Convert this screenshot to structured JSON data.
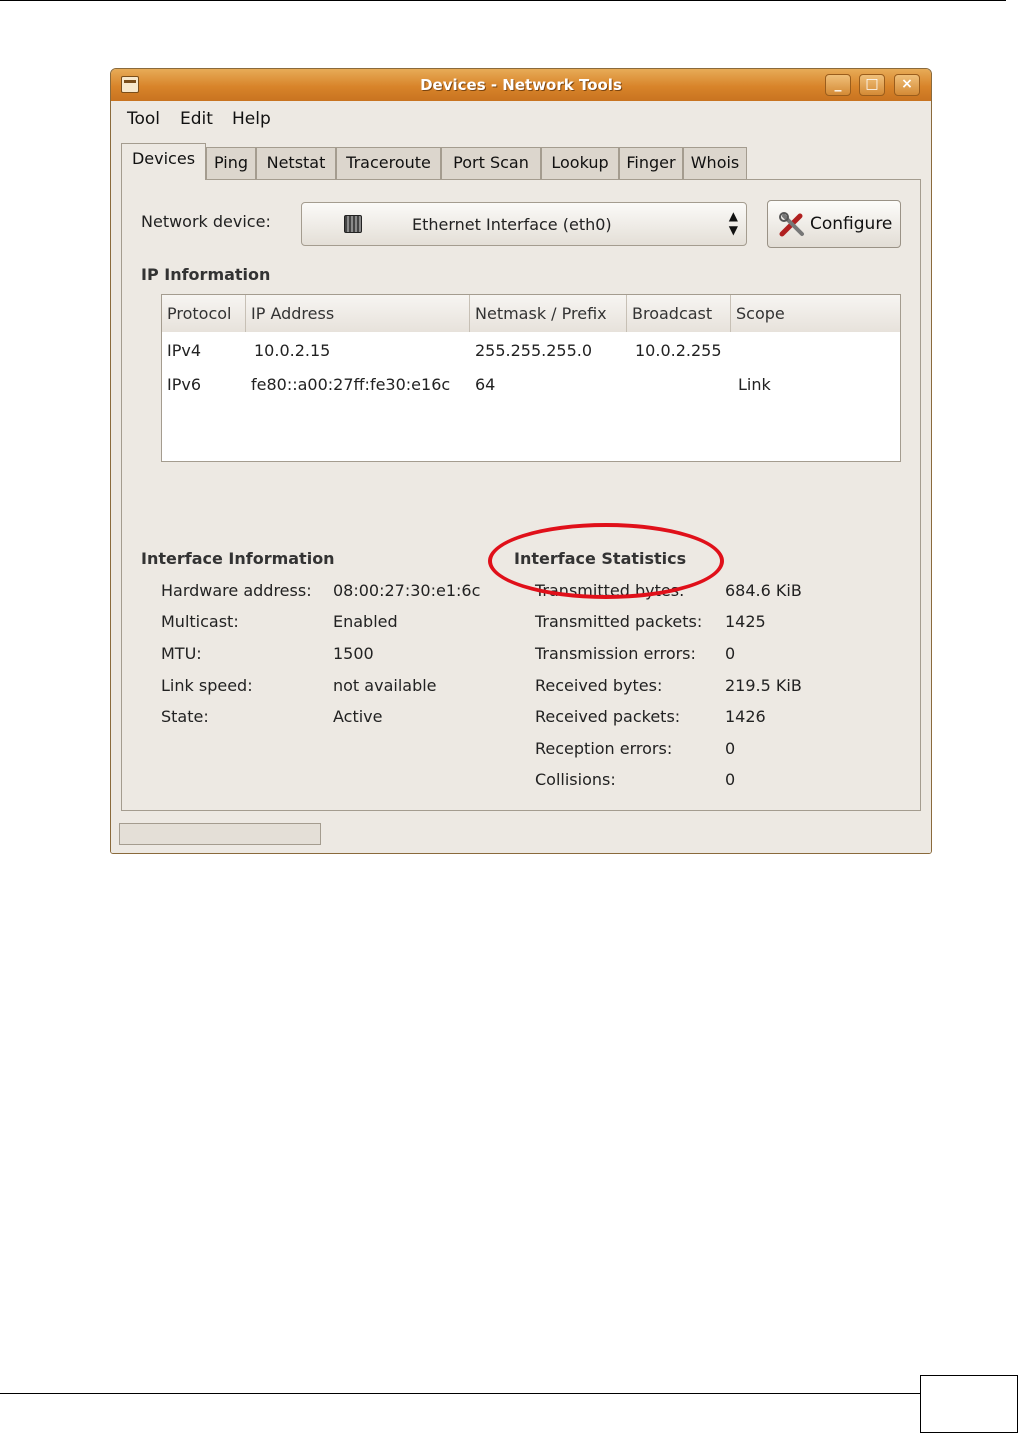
{
  "window": {
    "title": "Devices - Network Tools",
    "controls": [
      "_",
      "□",
      "×"
    ]
  },
  "menu": [
    "Tool",
    "Edit",
    "Help"
  ],
  "tabs": [
    "Devices",
    "Ping",
    "Netstat",
    "Traceroute",
    "Port Scan",
    "Lookup",
    "Finger",
    "Whois"
  ],
  "device": {
    "label": "Network device:",
    "selected": "Ethernet Interface (eth0)",
    "icon": "network-card-icon",
    "configure_label": "Configure"
  },
  "ip_info": {
    "title": "IP Information",
    "columns": [
      "Protocol",
      "IP Address",
      "Netmask / Prefix",
      "Broadcast",
      "Scope"
    ],
    "rows": [
      [
        "IPv4",
        "10.0.2.15",
        "255.255.255.0",
        "10.0.2.255",
        ""
      ],
      [
        "IPv6",
        "fe80::a00:27ff:fe30:e16c",
        "64",
        "",
        "Link"
      ]
    ]
  },
  "interface_info": {
    "title": "Interface Information",
    "items": [
      {
        "label": "Hardware address:",
        "value": "08:00:27:30:e1:6c"
      },
      {
        "label": "Multicast:",
        "value": "Enabled"
      },
      {
        "label": "MTU:",
        "value": "1500"
      },
      {
        "label": "Link speed:",
        "value": "not available"
      },
      {
        "label": "State:",
        "value": "Active"
      }
    ]
  },
  "interface_stats": {
    "title": "Interface Statistics",
    "items": [
      {
        "label": "Transmitted bytes:",
        "value": "684.6 KiB"
      },
      {
        "label": "Transmitted packets:",
        "value": "1425"
      },
      {
        "label": "Transmission errors:",
        "value": "0"
      },
      {
        "label": "Received bytes:",
        "value": "219.5 KiB"
      },
      {
        "label": "Received packets:",
        "value": "1426"
      },
      {
        "label": "Reception errors:",
        "value": "0"
      },
      {
        "label": "Collisions:",
        "value": "0"
      }
    ]
  },
  "colors": {
    "titlebar": "#d8842a",
    "highlight": "#e0101a",
    "window_bg": "#ede9e3"
  }
}
